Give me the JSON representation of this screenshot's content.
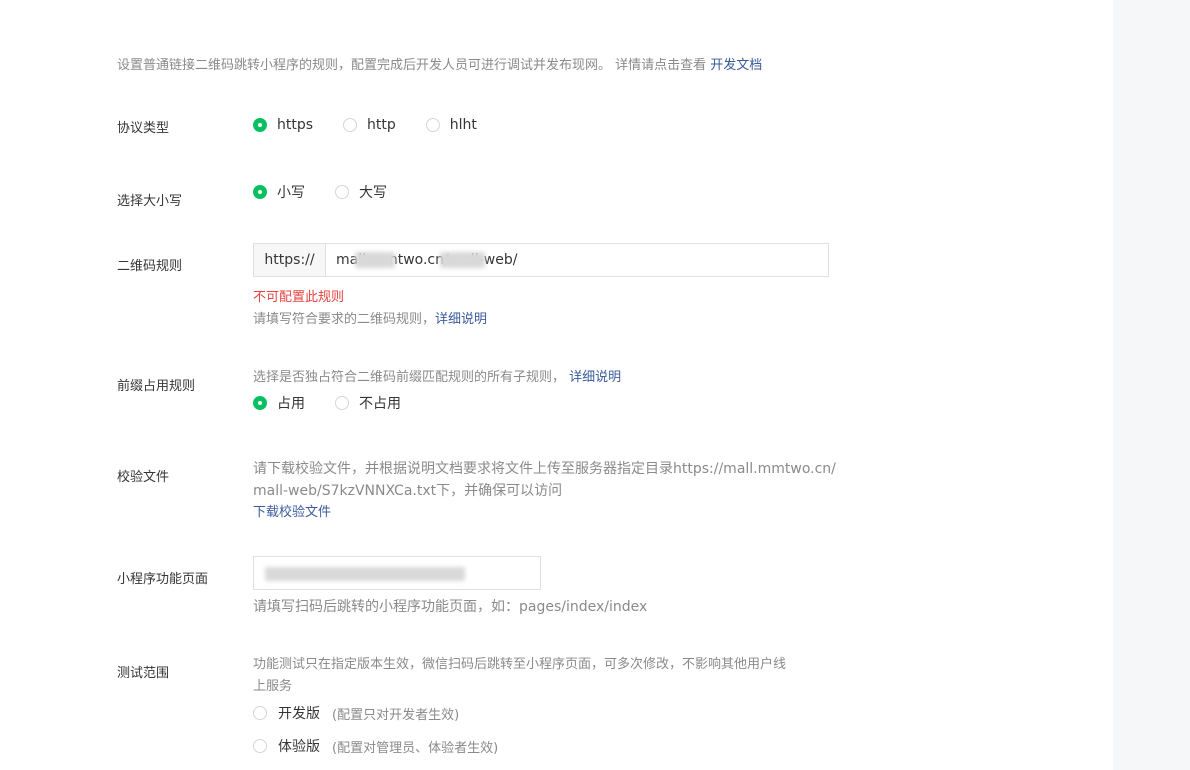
{
  "intro": {
    "text": "设置普通链接二维码跳转小程序的规则，配置完成后开发人员可进行调试并发布现网。 详情请点击查看",
    "link": "开发文档"
  },
  "protocol": {
    "label": "协议类型",
    "options": [
      {
        "label": "https",
        "checked": true
      },
      {
        "label": "http",
        "checked": false
      },
      {
        "label": "hlht",
        "checked": false
      }
    ]
  },
  "case": {
    "label": "选择大小写",
    "options": [
      {
        "label": "小写",
        "checked": true
      },
      {
        "label": "大写",
        "checked": false
      }
    ]
  },
  "qr_rule": {
    "label": "二维码规则",
    "prefix": "https://",
    "value": "mall.mmtwo.cn/mall-web/",
    "error": "不可配置此规则",
    "help": "请填写符合要求的二维码规则，",
    "help_link": "详细说明"
  },
  "prefix_rule": {
    "label": "前缀占用规则",
    "help": "选择是否独占符合二维码前缀匹配规则的所有子规则，",
    "help_link": "详细说明",
    "options": [
      {
        "label": "占用",
        "checked": true
      },
      {
        "label": "不占用",
        "checked": false
      }
    ]
  },
  "verify_file": {
    "label": "校验文件",
    "help_line1": "请下载校验文件，并根据说明文档要求将文件上传至服务器指定目录https://mall.mmtwo.cn/",
    "help_line2": "mall-web/S7kzVNNXCa.txt下，并确保可以访问",
    "download_link": "下载校验文件"
  },
  "function_page": {
    "label": "小程序功能页面",
    "value": "",
    "help": "请填写扫码后跳转的小程序功能页面，如：pages/index/index"
  },
  "test_range": {
    "label": "测试范围",
    "help_line1": "功能测试只在指定版本生效，微信扫码后跳转至小程序页面，可多次修改，不影响其他用户线",
    "help_line2": "上服务",
    "options": [
      {
        "label": "开发版",
        "note": "(配置只对开发者生效)"
      },
      {
        "label": "体验版",
        "note": "(配置对管理员、体验者生效)"
      }
    ]
  },
  "colors": {
    "accent": "#07c160",
    "link": "#3a5a9c",
    "error": "#e64340"
  }
}
